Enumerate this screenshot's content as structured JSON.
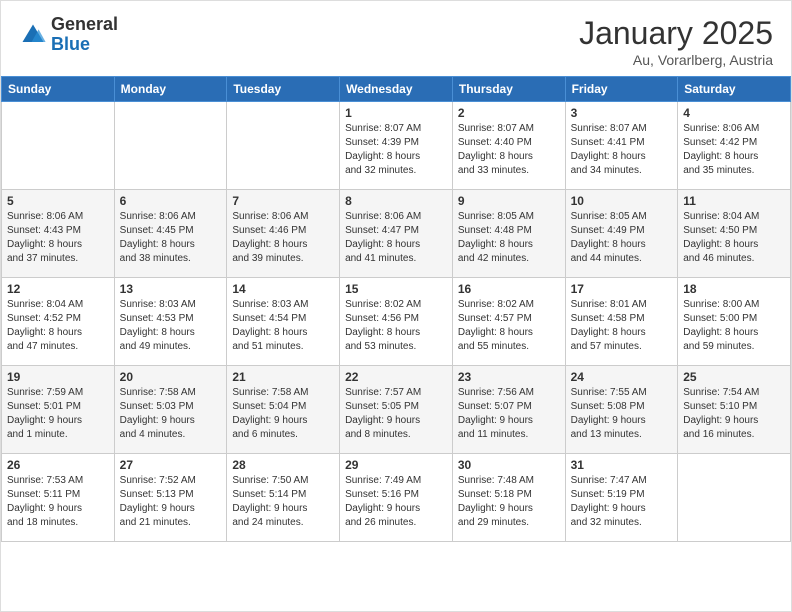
{
  "header": {
    "logo_general": "General",
    "logo_blue": "Blue",
    "month": "January 2025",
    "location": "Au, Vorarlberg, Austria"
  },
  "weekdays": [
    "Sunday",
    "Monday",
    "Tuesday",
    "Wednesday",
    "Thursday",
    "Friday",
    "Saturday"
  ],
  "weeks": [
    [
      {
        "day": "",
        "info": ""
      },
      {
        "day": "",
        "info": ""
      },
      {
        "day": "",
        "info": ""
      },
      {
        "day": "1",
        "info": "Sunrise: 8:07 AM\nSunset: 4:39 PM\nDaylight: 8 hours\nand 32 minutes."
      },
      {
        "day": "2",
        "info": "Sunrise: 8:07 AM\nSunset: 4:40 PM\nDaylight: 8 hours\nand 33 minutes."
      },
      {
        "day": "3",
        "info": "Sunrise: 8:07 AM\nSunset: 4:41 PM\nDaylight: 8 hours\nand 34 minutes."
      },
      {
        "day": "4",
        "info": "Sunrise: 8:06 AM\nSunset: 4:42 PM\nDaylight: 8 hours\nand 35 minutes."
      }
    ],
    [
      {
        "day": "5",
        "info": "Sunrise: 8:06 AM\nSunset: 4:43 PM\nDaylight: 8 hours\nand 37 minutes."
      },
      {
        "day": "6",
        "info": "Sunrise: 8:06 AM\nSunset: 4:45 PM\nDaylight: 8 hours\nand 38 minutes."
      },
      {
        "day": "7",
        "info": "Sunrise: 8:06 AM\nSunset: 4:46 PM\nDaylight: 8 hours\nand 39 minutes."
      },
      {
        "day": "8",
        "info": "Sunrise: 8:06 AM\nSunset: 4:47 PM\nDaylight: 8 hours\nand 41 minutes."
      },
      {
        "day": "9",
        "info": "Sunrise: 8:05 AM\nSunset: 4:48 PM\nDaylight: 8 hours\nand 42 minutes."
      },
      {
        "day": "10",
        "info": "Sunrise: 8:05 AM\nSunset: 4:49 PM\nDaylight: 8 hours\nand 44 minutes."
      },
      {
        "day": "11",
        "info": "Sunrise: 8:04 AM\nSunset: 4:50 PM\nDaylight: 8 hours\nand 46 minutes."
      }
    ],
    [
      {
        "day": "12",
        "info": "Sunrise: 8:04 AM\nSunset: 4:52 PM\nDaylight: 8 hours\nand 47 minutes."
      },
      {
        "day": "13",
        "info": "Sunrise: 8:03 AM\nSunset: 4:53 PM\nDaylight: 8 hours\nand 49 minutes."
      },
      {
        "day": "14",
        "info": "Sunrise: 8:03 AM\nSunset: 4:54 PM\nDaylight: 8 hours\nand 51 minutes."
      },
      {
        "day": "15",
        "info": "Sunrise: 8:02 AM\nSunset: 4:56 PM\nDaylight: 8 hours\nand 53 minutes."
      },
      {
        "day": "16",
        "info": "Sunrise: 8:02 AM\nSunset: 4:57 PM\nDaylight: 8 hours\nand 55 minutes."
      },
      {
        "day": "17",
        "info": "Sunrise: 8:01 AM\nSunset: 4:58 PM\nDaylight: 8 hours\nand 57 minutes."
      },
      {
        "day": "18",
        "info": "Sunrise: 8:00 AM\nSunset: 5:00 PM\nDaylight: 8 hours\nand 59 minutes."
      }
    ],
    [
      {
        "day": "19",
        "info": "Sunrise: 7:59 AM\nSunset: 5:01 PM\nDaylight: 9 hours\nand 1 minute."
      },
      {
        "day": "20",
        "info": "Sunrise: 7:58 AM\nSunset: 5:03 PM\nDaylight: 9 hours\nand 4 minutes."
      },
      {
        "day": "21",
        "info": "Sunrise: 7:58 AM\nSunset: 5:04 PM\nDaylight: 9 hours\nand 6 minutes."
      },
      {
        "day": "22",
        "info": "Sunrise: 7:57 AM\nSunset: 5:05 PM\nDaylight: 9 hours\nand 8 minutes."
      },
      {
        "day": "23",
        "info": "Sunrise: 7:56 AM\nSunset: 5:07 PM\nDaylight: 9 hours\nand 11 minutes."
      },
      {
        "day": "24",
        "info": "Sunrise: 7:55 AM\nSunset: 5:08 PM\nDaylight: 9 hours\nand 13 minutes."
      },
      {
        "day": "25",
        "info": "Sunrise: 7:54 AM\nSunset: 5:10 PM\nDaylight: 9 hours\nand 16 minutes."
      }
    ],
    [
      {
        "day": "26",
        "info": "Sunrise: 7:53 AM\nSunset: 5:11 PM\nDaylight: 9 hours\nand 18 minutes."
      },
      {
        "day": "27",
        "info": "Sunrise: 7:52 AM\nSunset: 5:13 PM\nDaylight: 9 hours\nand 21 minutes."
      },
      {
        "day": "28",
        "info": "Sunrise: 7:50 AM\nSunset: 5:14 PM\nDaylight: 9 hours\nand 24 minutes."
      },
      {
        "day": "29",
        "info": "Sunrise: 7:49 AM\nSunset: 5:16 PM\nDaylight: 9 hours\nand 26 minutes."
      },
      {
        "day": "30",
        "info": "Sunrise: 7:48 AM\nSunset: 5:18 PM\nDaylight: 9 hours\nand 29 minutes."
      },
      {
        "day": "31",
        "info": "Sunrise: 7:47 AM\nSunset: 5:19 PM\nDaylight: 9 hours\nand 32 minutes."
      },
      {
        "day": "",
        "info": ""
      }
    ]
  ]
}
